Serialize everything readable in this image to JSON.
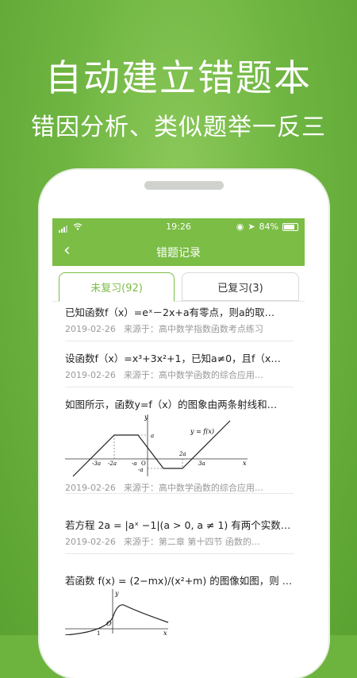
{
  "promo": {
    "headline": "自动建立错题本",
    "subline": "错因分析、类似题举一反三"
  },
  "status_bar": {
    "time": "19:26",
    "battery": "84%"
  },
  "nav": {
    "title": "错题记录"
  },
  "tabs": [
    {
      "label": "未复习(92)"
    },
    {
      "label": "已复习(3)"
    }
  ],
  "items": [
    {
      "question": "已知函数f（x）=eˣ－2x+a有零点，则a的取…",
      "date": "2019-02-26",
      "source": "来源于：高中数学指数函数考点练习"
    },
    {
      "question": "设函数f（x）=x³+3x²+1，已知a≠0，且f（x…",
      "date": "2019-02-26",
      "source": "来源于：高中数学函数的综合应用…"
    },
    {
      "question": "如图所示，函数y=f（x）的图象由两条射线和…",
      "date": "2019-02-26",
      "source": "来源于：高中数学函数的综合应用…"
    },
    {
      "question": "若方程 2a = |aˣ −1|(a > 0, a ≠ 1) 有两个实数解，…",
      "date": "2019-02-26",
      "source": "来源于：第二章 第十四节 函数的…"
    },
    {
      "question": "若函数 f(x) = (2−mx)/(x²+m) 的图像如图，则 m 的取值…",
      "date": "",
      "source": ""
    }
  ],
  "graph": {
    "y_label": "y",
    "x_label": "x",
    "origin": "O",
    "func": "y = f(x)",
    "ticks_x": [
      "-3a",
      "-2a",
      "-a",
      "2a",
      "3a"
    ],
    "tick_a": "a",
    "tick_neg_a": "-a"
  },
  "graph2": {
    "y": "y",
    "x": "x",
    "origin": "O",
    "one": "1"
  }
}
